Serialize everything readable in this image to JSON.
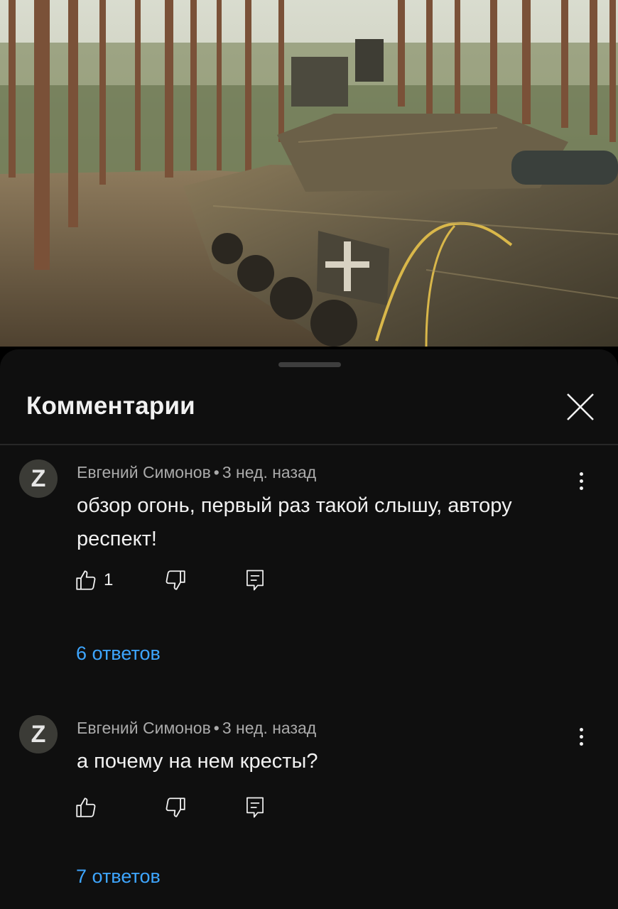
{
  "sheet": {
    "title": "Комментарии"
  },
  "comments": [
    {
      "avatar_letter": "Z",
      "author": "Евгений Симонов",
      "separator": "•",
      "time": "3 нед. назад",
      "text": "обзор огонь, первый раз такой слышу, автору респект!",
      "likes": "1",
      "replies": "6 ответов"
    },
    {
      "avatar_letter": "Z",
      "author": "Евгений Симонов",
      "separator": "•",
      "time": "3 нед. назад",
      "text": "а почему на нем кресты?",
      "likes": "",
      "replies": "7 ответов"
    }
  ],
  "icons": {
    "close": "close-icon",
    "more": "more-vertical-icon",
    "like": "thumbs-up-icon",
    "dislike": "thumbs-down-icon",
    "reply": "reply-comment-icon"
  },
  "colors": {
    "sheet_bg": "#0f0f0f",
    "link": "#3ea6ff",
    "secondary_text": "#aaaaaa"
  }
}
